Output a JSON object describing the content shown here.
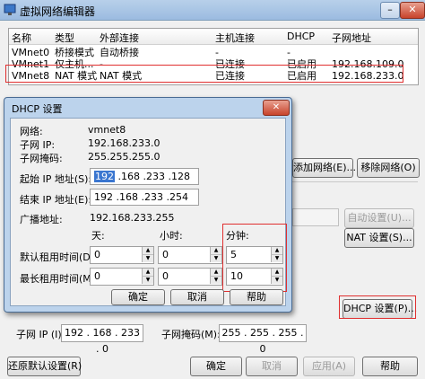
{
  "main": {
    "title": "虚拟网络编辑器",
    "minimize": "–",
    "close": "✕",
    "table": {
      "headers": [
        "名称",
        "类型",
        "外部连接",
        "主机连接",
        "DHCP",
        "子网地址"
      ],
      "rows": [
        [
          "VMnet0",
          "桥接模式",
          "自动桥接",
          "-",
          "-",
          ""
        ],
        [
          "VMnet1",
          "仅主机...",
          "-",
          "已连接",
          "已启用",
          "192.168.109.0"
        ],
        [
          "VMnet8",
          "NAT 模式",
          "NAT 模式",
          "已连接",
          "已启用",
          "192.168.233.0"
        ]
      ]
    },
    "add_network": "添加网络(E)...",
    "remove_network": "移除网络(O)",
    "auto_settings": "自动设置(U)...",
    "nat_settings": "NAT 设置(S)...",
    "dhcp_settings": "DHCP 设置(P)...",
    "subnet_ip_label": "子网 IP (I):",
    "subnet_ip_value": "192 . 168 . 233 . 0",
    "subnet_mask_label": "子网掩码(M):",
    "subnet_mask_value": "255 . 255 . 255 . 0",
    "restore_defaults": "还原默认设置(R)",
    "ok": "确定",
    "cancel": "取消",
    "apply": "应用(A)",
    "help": "帮助"
  },
  "dhcp": {
    "title": "DHCP 设置",
    "close": "✕",
    "network_label": "网络:",
    "network_value": "vmnet8",
    "subnet_ip_label": "子网 IP:",
    "subnet_ip_value": "192.168.233.0",
    "subnet_mask_label": "子网掩码:",
    "subnet_mask_value": "255.255.255.0",
    "start_ip_label": "起始 IP 地址(S):",
    "start_ip_first": "192",
    "start_ip_rest": " .168 .233 .128",
    "end_ip_label": "结束 IP 地址(E):",
    "end_ip_value": "192 .168 .233 .254",
    "broadcast_label": "广播地址:",
    "broadcast_value": "192.168.233.255",
    "days_label": "天:",
    "hours_label": "小时:",
    "minutes_label": "分钟:",
    "default_lease_label": "默认租用时间(D):",
    "max_lease_label": "最长租用时间(M):",
    "default_days": "0",
    "default_hours": "0",
    "default_minutes": "5",
    "max_days": "0",
    "max_hours": "0",
    "max_minutes": "10",
    "ok": "确定",
    "cancel": "取消",
    "help": "帮助"
  },
  "colors": {
    "highlight_border": "#e03030",
    "selection": "#3a76d0"
  }
}
